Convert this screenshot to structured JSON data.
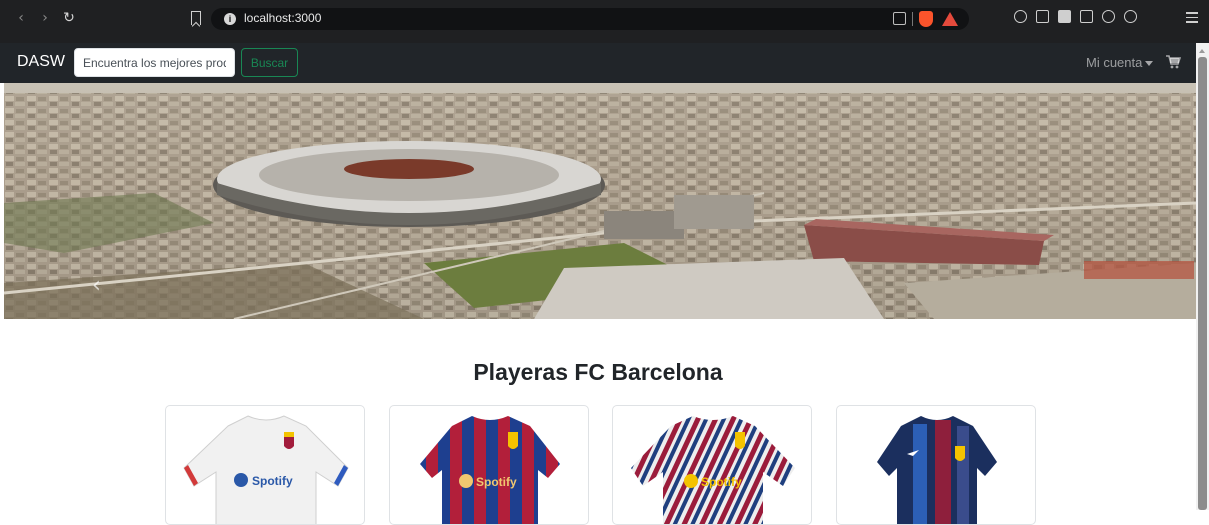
{
  "browser": {
    "url": "localhost:3000",
    "icons": [
      "back-icon",
      "forward-icon",
      "reload-icon",
      "bookmark-icon",
      "site-info-icon",
      "share-icon",
      "brave-shields-icon",
      "brave-rewards-icon",
      "extensions-icon",
      "downloads-icon",
      "sidebar-icon",
      "wallet-icon",
      "leo-icon",
      "vpn-icon",
      "menu-icon"
    ]
  },
  "navbar": {
    "brand": "DASW",
    "search_placeholder": "Encuentra los mejores productos",
    "search_button": "Buscar",
    "account_label": "Mi cuenta",
    "background": "#212529",
    "accent": "#198754"
  },
  "hero": {
    "description_icon": "stadium-aerial-image",
    "prev_control": "‹"
  },
  "main": {
    "title": "Playeras FC Barcelona",
    "products": [
      {
        "name": "white-jersey",
        "sponsor": "Spotify"
      },
      {
        "name": "blue-red-stripe-jersey",
        "sponsor": "Spotify"
      },
      {
        "name": "striped-jersey",
        "sponsor": "Spotify"
      },
      {
        "name": "blue-red-jersey"
      }
    ]
  }
}
